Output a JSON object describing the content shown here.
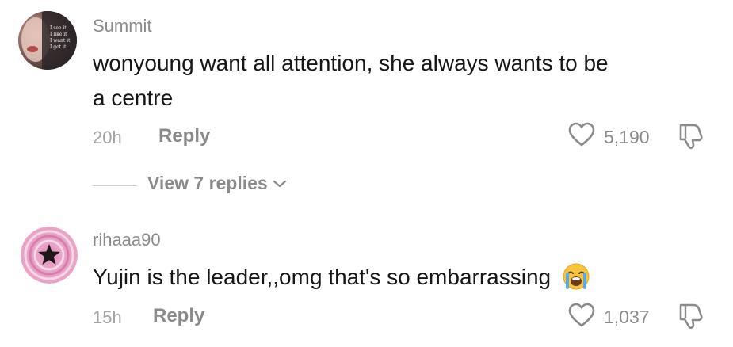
{
  "comments": [
    {
      "username": "Summit",
      "avatar_lines": [
        "I see it",
        "I like it",
        "I want it",
        "I got it"
      ],
      "text_line1": "wonyoung want all attention, she always wants to be",
      "text_line2": "a centre",
      "time": "20h",
      "reply_label": "Reply",
      "likes": "5,190",
      "view_replies": "View 7 replies",
      "icons": {
        "like": "heart-icon",
        "dislike": "thumbs-down-icon",
        "expand": "chevron-down-icon"
      }
    },
    {
      "username": "rihaaa90",
      "text": "Yujin is the leader,,omg that's so embarrassing",
      "emoji": "loudly-crying-face-emoji",
      "time": "15h",
      "reply_label": "Reply",
      "likes": "1,037",
      "icons": {
        "like": "heart-icon",
        "dislike": "thumbs-down-icon"
      }
    }
  ],
  "colors": {
    "text_primary": "#161616",
    "text_secondary": "#8a8a8a",
    "avatar2_pink": "#e9a3c7",
    "emoji_yellow": "#f8c43a",
    "emoji_tears": "#5aa9e6"
  }
}
